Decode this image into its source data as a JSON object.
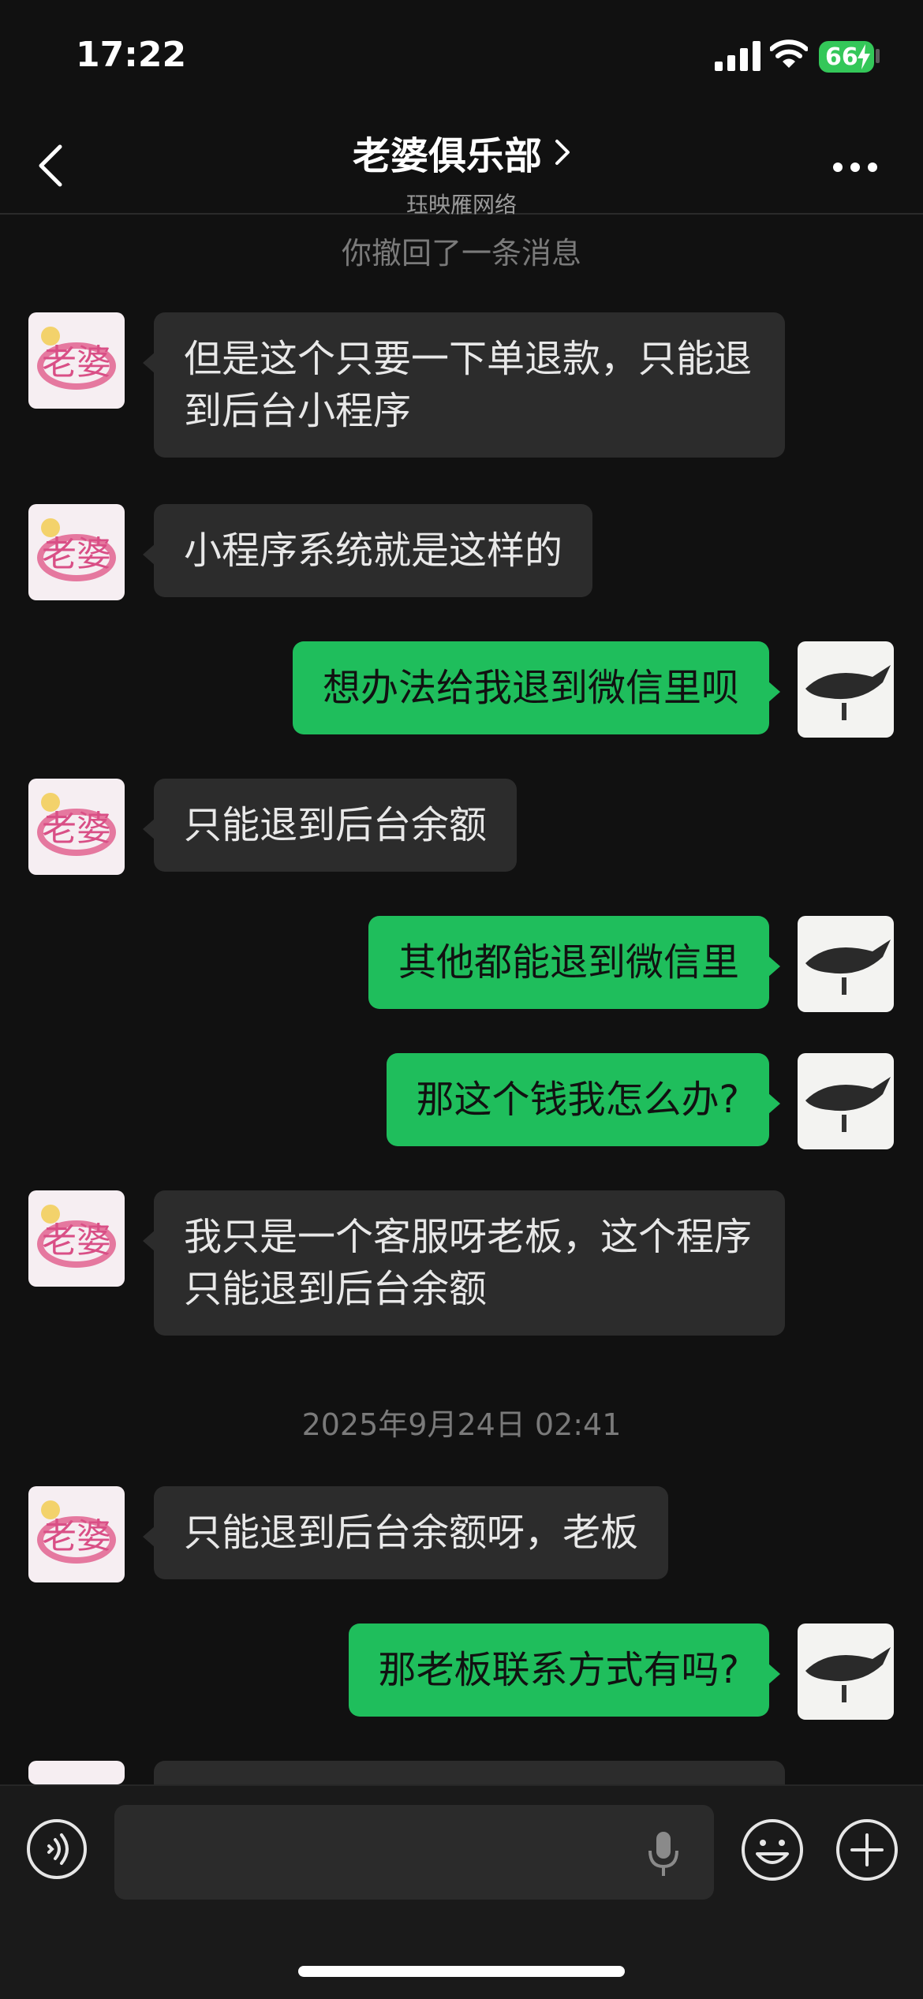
{
  "status_bar": {
    "time": "17:22",
    "battery": "66"
  },
  "header": {
    "title": "老婆俱乐部",
    "subtitle": "珏映雁网络"
  },
  "system": {
    "recall_notice": "你撤回了一条消息",
    "timestamp": "2025年9月24日 02:41"
  },
  "messages": [
    {
      "from": "them",
      "text": "但是这个只要一下单退款，只能退到后台小程序"
    },
    {
      "from": "them",
      "text": "小程序系统就是这样的"
    },
    {
      "from": "me",
      "text": "想办法给我退到微信里呗"
    },
    {
      "from": "them",
      "text": "只能退到后台余额"
    },
    {
      "from": "me",
      "text": "其他都能退到微信里"
    },
    {
      "from": "me",
      "text": "那这个钱我怎么办?"
    },
    {
      "from": "them",
      "text": "我只是一个客服呀老板，这个程序只能退到后台余额"
    },
    {
      "from": "them",
      "text": "只能退到后台余额呀，老板"
    },
    {
      "from": "me",
      "text": "那老板联系方式有吗?"
    }
  ],
  "icons": {
    "back": "chevron-left-icon",
    "more": "more-dots-icon",
    "voice": "voice-icon",
    "mic": "microphone-icon",
    "emoji": "emoji-icon",
    "plus": "plus-icon"
  },
  "colors": {
    "my_bubble": "#1fbe5c",
    "their_bubble": "#2c2c2c",
    "background": "#111111"
  }
}
